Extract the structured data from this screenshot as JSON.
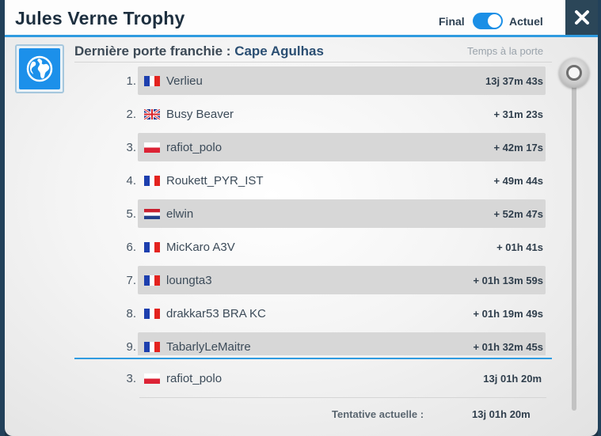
{
  "window": {
    "title": "Jules Verne Trophy"
  },
  "toggle": {
    "left_label": "Final",
    "right_label": "Actuel",
    "state": "on"
  },
  "icons": {
    "close": "close-icon",
    "globe": "globe-icon"
  },
  "gate": {
    "prefix": "Dernière porte franchie :",
    "name": "Cape Agulhas",
    "column_header": "Temps à la porte"
  },
  "rows": [
    {
      "rank": "1.",
      "flag": "fr",
      "name": "Verlieu",
      "time": "13j 37m 43s"
    },
    {
      "rank": "2.",
      "flag": "gb",
      "name": "Busy Beaver",
      "time": "+ 31m 23s"
    },
    {
      "rank": "3.",
      "flag": "pl",
      "name": "rafiot_polo",
      "time": "+ 42m 17s"
    },
    {
      "rank": "4.",
      "flag": "fr",
      "name": "Roukett_PYR_IST",
      "time": "+ 49m 44s"
    },
    {
      "rank": "5.",
      "flag": "nl",
      "name": "elwin",
      "time": "+ 52m 47s"
    },
    {
      "rank": "6.",
      "flag": "fr",
      "name": "MicKaro A3V",
      "time": "+ 01h 41s"
    },
    {
      "rank": "7.",
      "flag": "fr",
      "name": "loungta3",
      "time": "+ 01h 13m 59s"
    },
    {
      "rank": "8.",
      "flag": "fr",
      "name": "drakkar53 BRA KC",
      "time": "+ 01h 19m 49s"
    },
    {
      "rank": "9.",
      "flag": "fr",
      "name": "TabarlyLeMaitre",
      "time": "+ 01h 32m 45s"
    }
  ],
  "my_row": {
    "rank": "3.",
    "flag": "pl",
    "name": "rafiot_polo",
    "time": "13j 01h 20m"
  },
  "attempt": {
    "label": "Tentative actuelle :",
    "value": "13j 01h 20m"
  },
  "colors": {
    "accent": "#2f9be0",
    "header_dark": "#2b4658",
    "row_alt": "#d7d7d7"
  }
}
